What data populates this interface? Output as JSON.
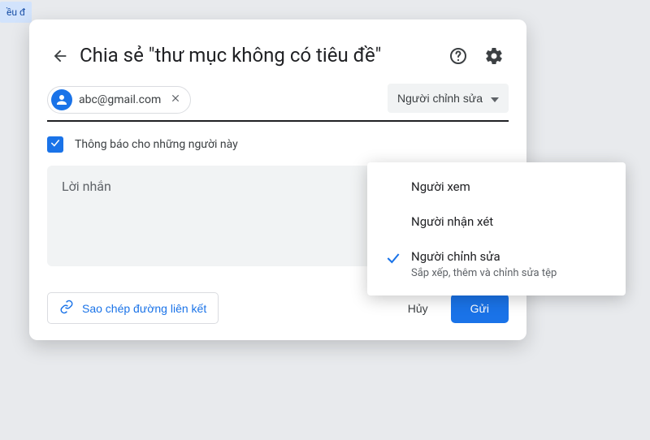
{
  "bg_chip": "ều đ",
  "header": {
    "title": "Chia sẻ \"thư mục không có tiêu đề\""
  },
  "chip": {
    "email": "abc@gmail.com"
  },
  "role_button": {
    "label": "Người chỉnh sửa"
  },
  "notify": {
    "label": "Thông báo cho những người này",
    "checked": true
  },
  "message": {
    "placeholder": "Lời nhắn"
  },
  "footer": {
    "copy_link": "Sao chép đường liên kết",
    "cancel": "Hủy",
    "send": "Gửi"
  },
  "dropdown": {
    "items": [
      {
        "label": "Người xem",
        "sub": "",
        "selected": false
      },
      {
        "label": "Người nhận xét",
        "sub": "",
        "selected": false
      },
      {
        "label": "Người chỉnh sửa",
        "sub": "Sắp xếp, thêm và chỉnh sửa tệp",
        "selected": true
      }
    ]
  }
}
